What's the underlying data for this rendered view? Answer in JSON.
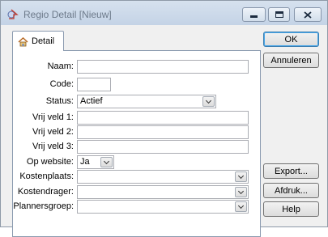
{
  "window": {
    "title": "Regio Detail [Nieuw]",
    "icons": {
      "app": "regio-app-icon",
      "minimize": "minimize-icon",
      "maximize": "maximize-icon",
      "close": "close-icon"
    }
  },
  "tabs": [
    {
      "label": "Detail",
      "icon": "house-icon",
      "active": true
    }
  ],
  "form": {
    "naam": {
      "label": "Naam:",
      "value": ""
    },
    "code": {
      "label": "Code:",
      "value": ""
    },
    "status": {
      "label": "Status:",
      "value": "Actief"
    },
    "vrij_veld_1": {
      "label": "Vrij veld 1:",
      "value": ""
    },
    "vrij_veld_2": {
      "label": "Vrij veld 2:",
      "value": ""
    },
    "vrij_veld_3": {
      "label": "Vrij veld 3:",
      "value": ""
    },
    "op_website": {
      "label": "Op website:",
      "value": "Ja"
    },
    "kostenplaats": {
      "label": "Kostenplaats:",
      "value": ""
    },
    "kostendrager": {
      "label": "Kostendrager:",
      "value": ""
    },
    "plannersgroep": {
      "label": "Plannersgroep:",
      "value": ""
    }
  },
  "buttons": {
    "ok": "OK",
    "annuleren": "Annuleren",
    "export": "Export...",
    "afdruk": "Afdruk...",
    "help": "Help"
  },
  "colors": {
    "window_bg": "#f0f0f0",
    "titlebar": "#c4d3e6",
    "default_button_border": "#3c7fb1"
  }
}
